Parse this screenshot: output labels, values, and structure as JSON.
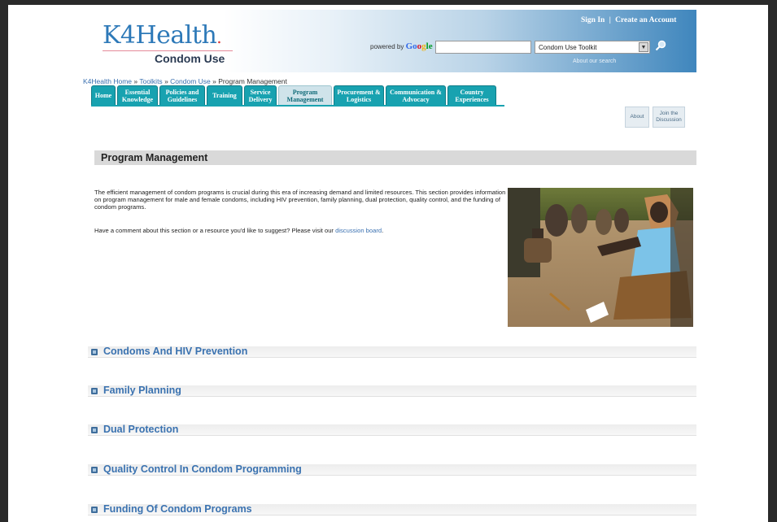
{
  "header": {
    "logo_text": "K4Health",
    "site_subtitle": "Condom Use",
    "powered_by": "powered by",
    "google_parts": [
      "Go",
      "o",
      "g",
      "le"
    ],
    "search_placeholder": "",
    "search_select_value": "Condom Use Toolkit",
    "about_search": "About our search",
    "sign_in": "Sign In",
    "separator": "|",
    "create_account": "Create an Account"
  },
  "breadcrumb": {
    "items": [
      "K4Health Home",
      "Toolkits",
      "Condom Use"
    ],
    "separator": "»",
    "current": "Program Management"
  },
  "nav": {
    "tabs": [
      {
        "label": "Home"
      },
      {
        "label": "Essential Knowledge"
      },
      {
        "label": "Policies and Guidelines"
      },
      {
        "label": "Training"
      },
      {
        "label": "Service Delivery"
      },
      {
        "label": "Program Management"
      },
      {
        "label": "Procurement & Logistics"
      },
      {
        "label": "Communication & Advocacy"
      },
      {
        "label": "Country Experiences"
      }
    ],
    "active_index": 5
  },
  "side_buttons": {
    "about": "About",
    "join": "Join the Discussion"
  },
  "main": {
    "title": "Program Management",
    "intro": "The efficient management of condom programs is crucial during this era of increasing demand and limited resources. This section provides information on program management for male and female condoms, including HIV prevention, family planning, dual protection, quality control, and the funding of condom programs.",
    "comment_prefix": "Have a comment about this section or a resource you'd like to suggest? Please visit our",
    "comment_link": "discussion board",
    "comment_suffix": "."
  },
  "sections": [
    {
      "label": "Condoms And HIV Prevention"
    },
    {
      "label": "Family Planning"
    },
    {
      "label": "Dual Protection"
    },
    {
      "label": "Quality Control In Condom Programming"
    },
    {
      "label": "Funding Of Condom Programs"
    }
  ],
  "colors": {
    "tab_bg": "#18a2b0",
    "tab_active_bg": "#cfe3ea",
    "link": "#3a70b0",
    "header_blue": "#3f86bd"
  }
}
